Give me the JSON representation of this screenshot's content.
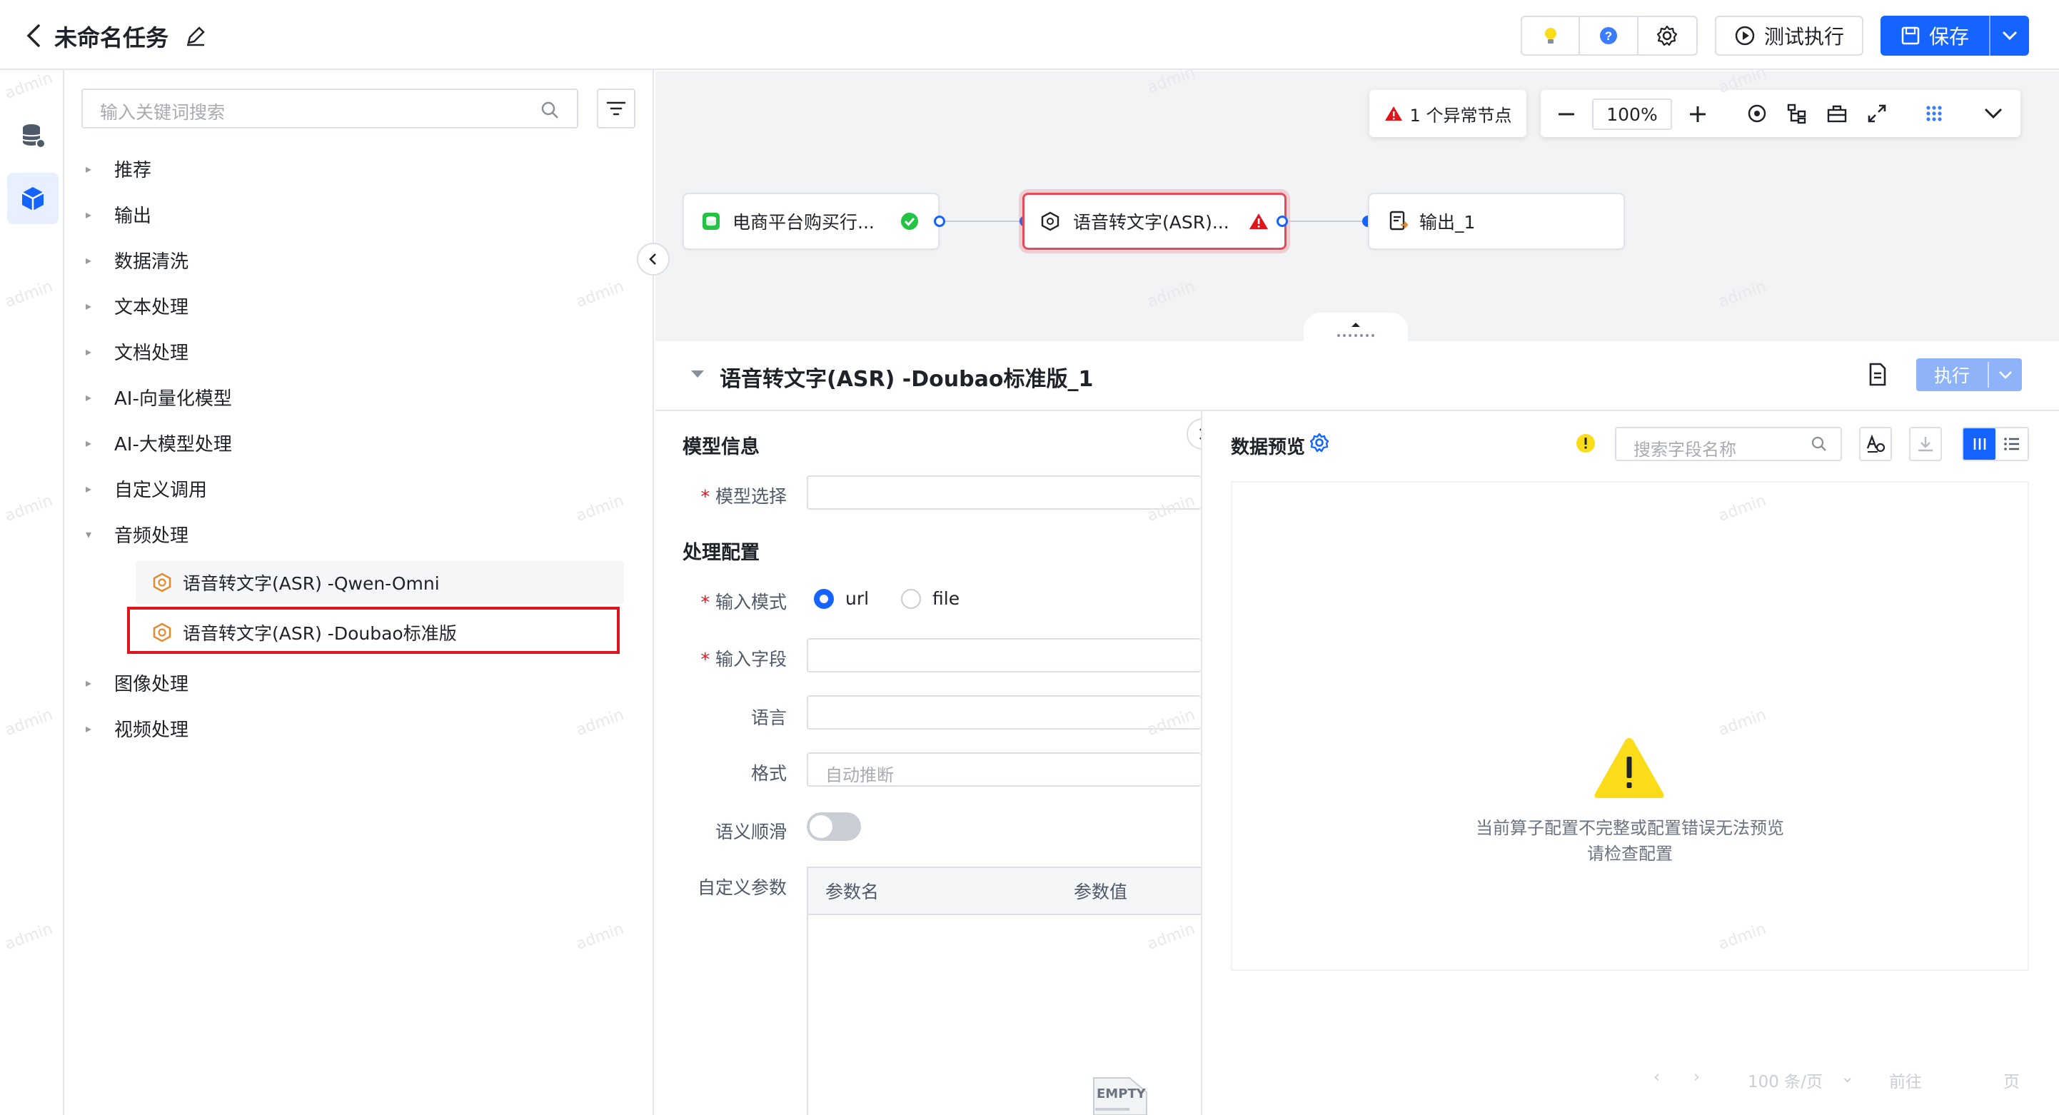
{
  "header": {
    "title": "未命名任务",
    "test_run_label": "测试执行",
    "save_label": "保存"
  },
  "operator_panel": {
    "search_placeholder": "输入关键词搜索",
    "categories": [
      {
        "label": "推荐",
        "expanded": false
      },
      {
        "label": "输出",
        "expanded": false
      },
      {
        "label": "数据清洗",
        "expanded": false
      },
      {
        "label": "文本处理",
        "expanded": false
      },
      {
        "label": "文档处理",
        "expanded": false
      },
      {
        "label": "AI-向量化模型",
        "expanded": false
      },
      {
        "label": "AI-大模型处理",
        "expanded": false
      },
      {
        "label": "自定义调用",
        "expanded": false
      },
      {
        "label": "音频处理",
        "expanded": true
      },
      {
        "label": "图像处理",
        "expanded": false
      },
      {
        "label": "视频处理",
        "expanded": false
      }
    ],
    "audio_items": [
      {
        "label": "语音转文字(ASR) -Qwen-Omni"
      },
      {
        "label": "语音转文字(ASR) -Doubao标准版",
        "highlighted": true
      }
    ]
  },
  "canvas": {
    "abnormal_count_label": "1 个异常节点",
    "zoom": "100%",
    "nodes": [
      {
        "label": "电商平台购买行...",
        "status": "ok"
      },
      {
        "label": "语音转文字(ASR)...",
        "status": "error"
      },
      {
        "label": "输出_1",
        "status": "none"
      }
    ]
  },
  "config": {
    "title": "语音转文字(ASR) -Doubao标准版_1",
    "run_label": "执行",
    "model_section": "模型信息",
    "model_select_label": "模型选择",
    "process_section": "处理配置",
    "input_mode_label": "输入模式",
    "input_mode_options": [
      {
        "label": "url",
        "selected": true
      },
      {
        "label": "file",
        "selected": false
      }
    ],
    "input_field_label": "输入字段",
    "language_label": "语言",
    "format_label": "格式",
    "format_placeholder": "自动推断",
    "semantic_smooth_label": "语义顺滑",
    "semantic_smooth_on": false,
    "custom_params_label": "自定义参数",
    "param_name_header": "参数名",
    "param_value_header": "参数值",
    "empty_label": "EMPTY"
  },
  "preview": {
    "title": "数据预览",
    "search_placeholder": "搜索字段名称",
    "error_line1": "当前算子配置不完整或配置错误无法预览",
    "error_line2": "请检查配置",
    "page_size": "100 条/页",
    "goto_label": "前往",
    "page_unit": "页"
  },
  "watermark": "admin",
  "colors": {
    "primary": "#1664ff",
    "error": "#e34d59",
    "success": "#23c343",
    "warning": "#fadc19"
  }
}
